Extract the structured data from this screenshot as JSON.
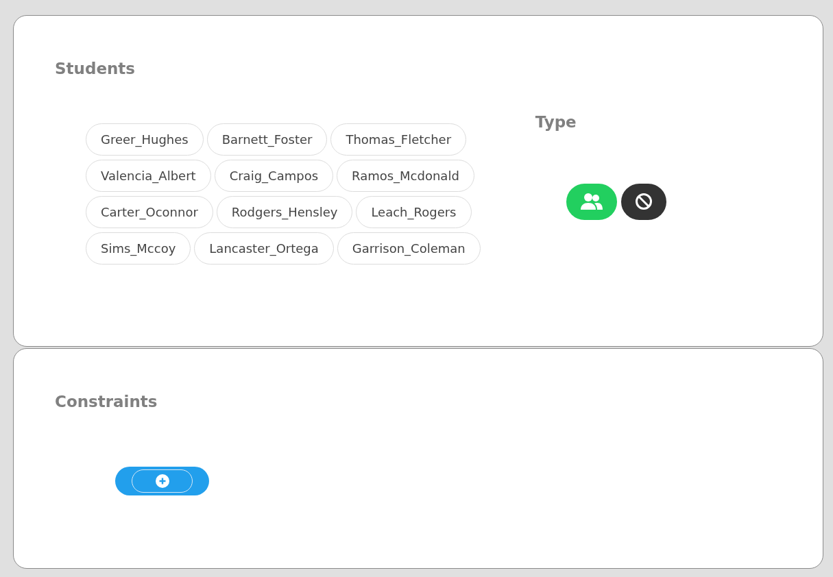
{
  "students": {
    "title": "Students",
    "items": [
      "Greer_Hughes",
      "Barnett_Foster",
      "Thomas_Fletcher",
      "Valencia_Albert",
      "Craig_Campos",
      "Ramos_Mcdonald",
      "Carter_Oconnor",
      "Rodgers_Hensley",
      "Leach_Rogers",
      "Sims_Mccoy",
      "Lancaster_Ortega",
      "Garrison_Coleman"
    ]
  },
  "type": {
    "title": "Type",
    "options": [
      {
        "kind": "group",
        "selected": true
      },
      {
        "kind": "none",
        "selected": false
      }
    ]
  },
  "constraints": {
    "title": "Constraints"
  }
}
